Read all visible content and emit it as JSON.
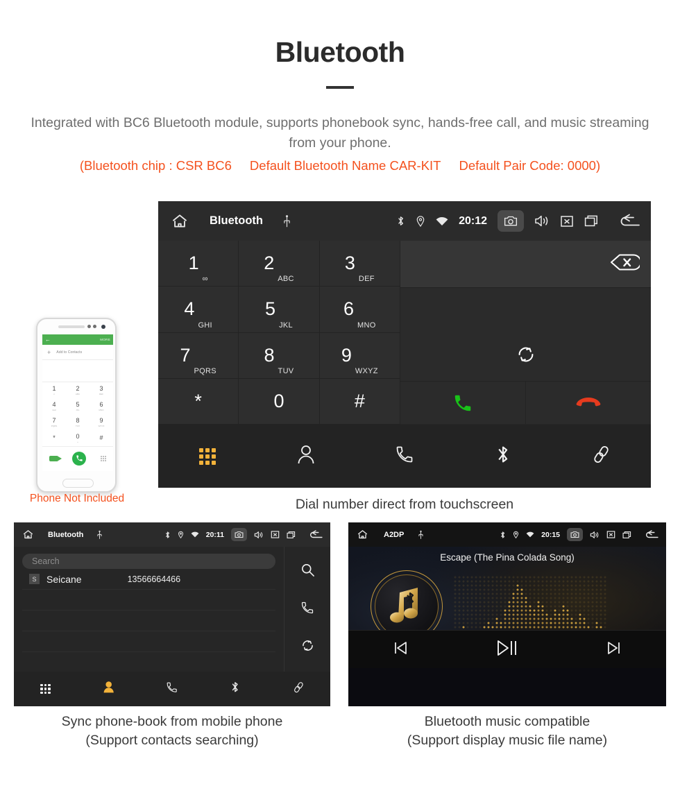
{
  "header": {
    "title": "Bluetooth",
    "description": "Integrated with BC6 Bluetooth module, supports phonebook sync, hands-free call, and music streaming from your phone.",
    "note_chip": "(Bluetooth chip : CSR BC6",
    "note_name": "Default Bluetooth Name CAR-KIT",
    "note_pair": "Default Pair Code: 0000)",
    "accent_color": "#f4511e",
    "text_color": "#6e6e6e"
  },
  "dialer": {
    "statusbar": {
      "home_icon": "home-icon",
      "title": "Bluetooth",
      "usb_icon": "usb-icon",
      "bluetooth_icon": "bluetooth-icon",
      "location_icon": "location-icon",
      "wifi_icon": "wifi-icon",
      "clock": "20:12",
      "camera_icon": "camera-icon",
      "volume_icon": "volume-icon",
      "close_icon": "close-box-icon",
      "recents_icon": "recents-icon",
      "back_icon": "back-arrow-icon"
    },
    "keys": [
      {
        "digit": "1",
        "letters": "∞",
        "sub": ""
      },
      {
        "digit": "2",
        "letters": "ABC",
        "sub": ""
      },
      {
        "digit": "3",
        "letters": "DEF",
        "sub": ""
      },
      {
        "digit": "4",
        "letters": "GHI",
        "sub": ""
      },
      {
        "digit": "5",
        "letters": "JKL",
        "sub": ""
      },
      {
        "digit": "6",
        "letters": "MNO",
        "sub": ""
      },
      {
        "digit": "7",
        "letters": "PQRS",
        "sub": ""
      },
      {
        "digit": "8",
        "letters": "TUV",
        "sub": ""
      },
      {
        "digit": "9",
        "letters": "WXYZ",
        "sub": ""
      },
      {
        "digit": "*",
        "letters": "",
        "sub": ""
      },
      {
        "digit": "0",
        "letters": "",
        "sub": "+"
      },
      {
        "digit": "#",
        "letters": "",
        "sub": ""
      }
    ],
    "number_value": "",
    "backspace_icon": "backspace-icon",
    "sync_icon": "sync-icon",
    "call_icon": "call-icon",
    "hangup_icon": "hangup-icon",
    "call_color": "#19c219",
    "hangup_color": "#e63b1e",
    "navbar": [
      {
        "icon": "keypad-icon",
        "active": true
      },
      {
        "icon": "contacts-icon",
        "active": false
      },
      {
        "icon": "call-log-icon",
        "active": false
      },
      {
        "icon": "bluetooth-icon",
        "active": false
      },
      {
        "icon": "link-icon",
        "active": false
      }
    ],
    "active_color": "#f2b23a",
    "caption": "Dial number direct from touchscreen"
  },
  "phone_mockup": {
    "appbar_back": "←",
    "appbar_more": "MORE",
    "add_contact_label": "Add to Contacts",
    "keys": [
      {
        "n": "1",
        "s": "∞"
      },
      {
        "n": "2",
        "s": "ABC"
      },
      {
        "n": "3",
        "s": "DEF"
      },
      {
        "n": "4",
        "s": "GHI"
      },
      {
        "n": "5",
        "s": "JKL"
      },
      {
        "n": "6",
        "s": "MNO"
      },
      {
        "n": "7",
        "s": "PQRS"
      },
      {
        "n": "8",
        "s": "TUV"
      },
      {
        "n": "9",
        "s": "WXYZ"
      },
      {
        "n": "*",
        "s": ""
      },
      {
        "n": "0",
        "s": "+"
      },
      {
        "n": "#",
        "s": ""
      }
    ],
    "bt_icon": "bluetooth-signal-icon",
    "disclaimer": "Phone Not Included",
    "disclaimer_color": "#f4511e"
  },
  "phonebook": {
    "statusbar": {
      "home_icon": "home-icon",
      "title": "Bluetooth",
      "usb_icon": "usb-icon",
      "clock": "20:11",
      "camera_icon": "camera-icon",
      "volume_icon": "volume-icon",
      "close_icon": "close-box-icon",
      "recents_icon": "recents-icon",
      "back_icon": "back-arrow-icon"
    },
    "search_placeholder": "Search",
    "search_value": "",
    "contacts": [
      {
        "initial": "S",
        "name": "Seicane",
        "number": "13566664466"
      }
    ],
    "side_icons": [
      "search-icon",
      "call-icon",
      "sync-icon"
    ],
    "navbar": [
      {
        "icon": "keypad-icon",
        "active": false
      },
      {
        "icon": "contacts-icon",
        "active": true
      },
      {
        "icon": "call-log-icon",
        "active": false
      },
      {
        "icon": "bluetooth-icon",
        "active": false
      },
      {
        "icon": "link-icon",
        "active": false
      }
    ],
    "active_color": "#f2b23a",
    "caption_line1": "Sync phone-book from mobile phone",
    "caption_line2": "(Support contacts searching)"
  },
  "music": {
    "statusbar": {
      "home_icon": "home-icon",
      "title": "A2DP",
      "usb_icon": "usb-icon",
      "clock": "20:15",
      "camera_icon": "camera-icon",
      "volume_icon": "volume-icon",
      "close_icon": "close-box-icon",
      "recents_icon": "recents-icon",
      "back_icon": "back-arrow-icon"
    },
    "song_title": "Escape (The Pina Colada Song)",
    "logo_icon": "bluetooth-music-note-icon",
    "equalizer_icon": "dot-matrix-equalizer",
    "accent_color": "#d1a23f",
    "controls": [
      {
        "icon": "previous-track-icon"
      },
      {
        "icon": "play-pause-icon"
      },
      {
        "icon": "next-track-icon"
      }
    ],
    "caption_line1": "Bluetooth music compatible",
    "caption_line2": "(Support display music file name)"
  }
}
